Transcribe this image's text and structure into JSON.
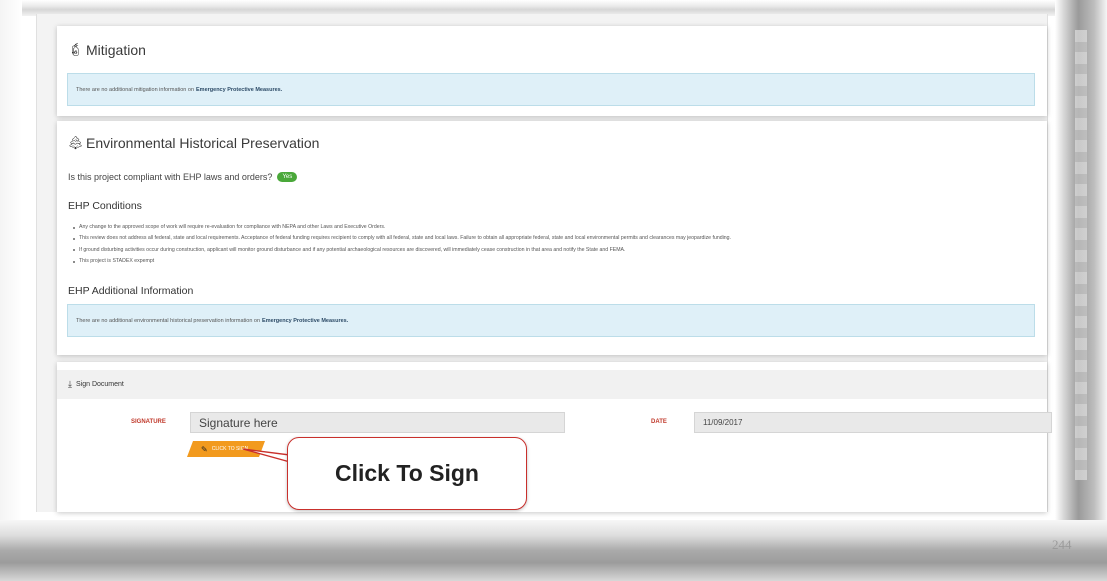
{
  "mitigation": {
    "title": "Mitigation",
    "icon": "fire-extinguisher-icon",
    "info_text": "There are no additional mitigation information on",
    "info_link": "Emergency Protective Measures."
  },
  "ehp": {
    "title": "Environmental Historical Preservation",
    "icon": "tree-icon",
    "question": "Is this project compliant with EHP laws and orders?",
    "answer": "Yes",
    "conditions_title": "EHP Conditions",
    "conditions": [
      "Any change to the approved scope of work will require re-evaluation for compliance with NEPA and other Laws and Executive Orders.",
      "This review does not address all federal, state and local requirements. Acceptance of federal funding requires recipient to comply with all federal, state and local laws. Failure to obtain all appropriate federal, state and local environmental permits and clearances may jeopardize funding.",
      "If ground disturbing activities occur during construction, applicant will monitor ground disturbance and if any potential archaeological resources are discovered, will immediately cease construction in that area and notify the State and FEMA.",
      "This project is STADEX expempt"
    ],
    "additional_title": "EHP Additional Information",
    "info_text": "There are no additional environmental historical preservation information on",
    "info_link": "Emergency Protective Measures."
  },
  "sign": {
    "header": "Sign Document",
    "icon": "download-icon",
    "signature_label": "SIGNATURE",
    "signature_value": "Signature here",
    "date_label": "DATE",
    "date_value": "11/09/2017",
    "button_label": "CLICK TO SIGN",
    "button_icon": "pencil-icon"
  },
  "callout": {
    "text": "Click To Sign",
    "border_color": "#c9302c"
  },
  "page_number": "244",
  "colors": {
    "info_bg": "#dff0f8",
    "badge_green": "#4aa83a",
    "button_orange": "#f29a1e",
    "label_red": "#c0392b"
  }
}
